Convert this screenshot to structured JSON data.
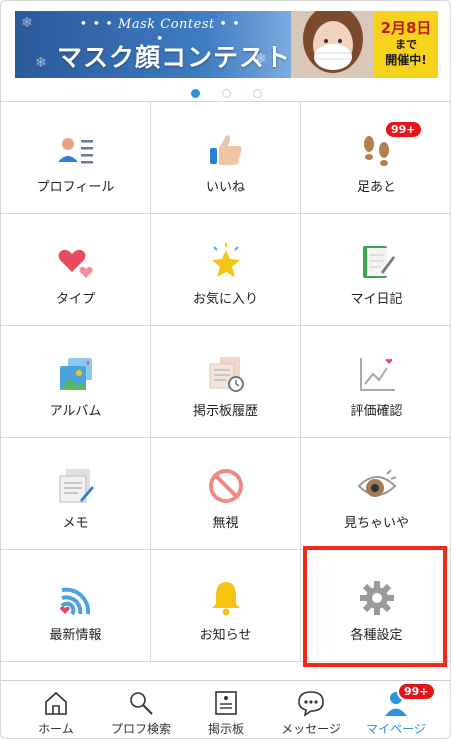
{
  "banner": {
    "eyebrow": "• • • Mask Contest • • •",
    "title": "マスク顔コンテスト",
    "date_line1": "2月8日",
    "date_line2": "まで",
    "date_line3": "開催中!"
  },
  "carousel": {
    "count": 3,
    "active": 0
  },
  "grid": [
    {
      "label": "プロフィール",
      "icon": "profile-icon"
    },
    {
      "label": "いいね",
      "icon": "thumbs-up-icon"
    },
    {
      "label": "足あと",
      "icon": "footprints-icon",
      "badge": "99+"
    },
    {
      "label": "タイプ",
      "icon": "hearts-icon"
    },
    {
      "label": "お気に入り",
      "icon": "star-icon"
    },
    {
      "label": "マイ日記",
      "icon": "diary-icon"
    },
    {
      "label": "アルバム",
      "icon": "album-icon"
    },
    {
      "label": "掲示板履歴",
      "icon": "board-history-icon"
    },
    {
      "label": "評価確認",
      "icon": "rating-chart-icon"
    },
    {
      "label": "メモ",
      "icon": "memo-icon"
    },
    {
      "label": "無視",
      "icon": "block-icon"
    },
    {
      "label": "見ちゃいや",
      "icon": "eye-icon"
    },
    {
      "label": "最新情報",
      "icon": "feed-icon"
    },
    {
      "label": "お知らせ",
      "icon": "bell-icon"
    },
    {
      "label": "各種設定",
      "icon": "gear-icon"
    }
  ],
  "tabs": [
    {
      "label": "ホーム",
      "icon": "home-icon"
    },
    {
      "label": "プロフ検索",
      "icon": "search-icon"
    },
    {
      "label": "掲示板",
      "icon": "board-icon"
    },
    {
      "label": "メッセージ",
      "icon": "chat-icon"
    },
    {
      "label": "マイページ",
      "icon": "user-icon",
      "badge": "99+",
      "active": true
    }
  ],
  "colors": {
    "accent": "#2b93e0",
    "badge": "#e8141c",
    "highlight": "#f2281a"
  }
}
